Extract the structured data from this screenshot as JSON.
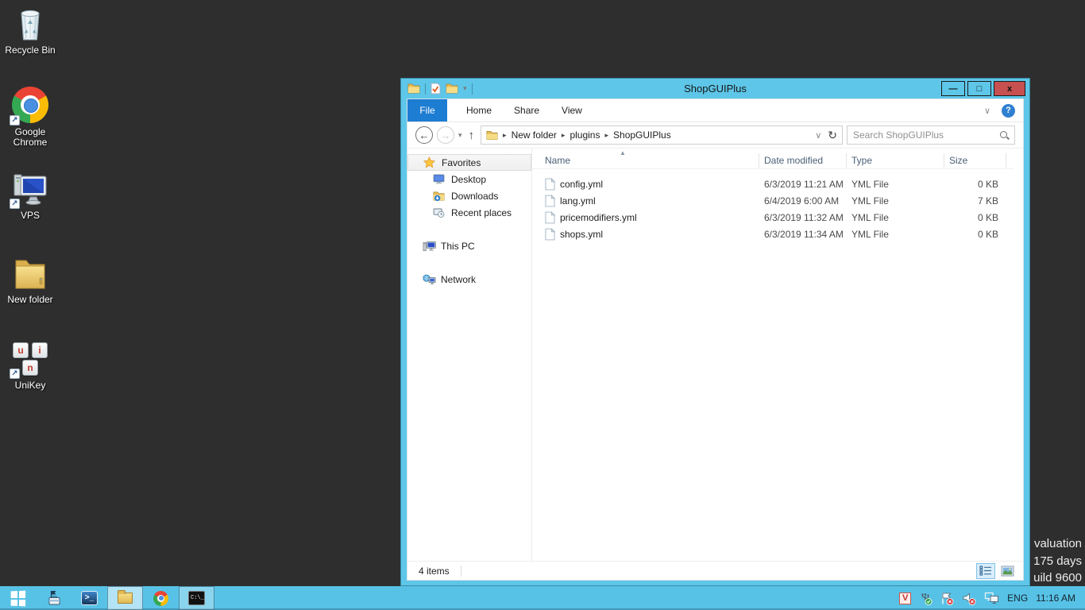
{
  "colors": {
    "desktop_bg": "#2e2e2e",
    "window_frame_blue": "#5ec6e8",
    "taskbar_blue": "#58c2e6",
    "close_button_red": "#c75050",
    "file_tab_blue": "#1d7dd2",
    "accent_blue": "#2f80d0"
  },
  "desktop": {
    "icons": [
      {
        "icon": "recycle-bin-icon",
        "label": "Recycle Bin"
      },
      {
        "icon": "chrome-icon",
        "label": "Google Chrome"
      },
      {
        "icon": "remote-pc-icon",
        "label": "VPS"
      },
      {
        "icon": "folder-icon",
        "label": "New folder"
      },
      {
        "icon": "unikey-icon",
        "label": "UniKey"
      }
    ],
    "evaluation_lines": {
      "0": "valuation",
      "1": "175 days",
      "2": "uild 9600"
    }
  },
  "explorer": {
    "title": "ShopGUIPlus",
    "qat_icons": [
      "explorer-window-icon",
      "properties-icon",
      "new-folder-icon",
      "customize-qat-dropdown"
    ],
    "caption": {
      "minimize": "–",
      "maximize": "▫",
      "close": "x"
    },
    "tabs": {
      "0": "File",
      "1": "Home",
      "2": "Share",
      "3": "View"
    },
    "breadcrumb": {
      "0": "New folder",
      "1": "plugins",
      "2": "ShopGUIPlus"
    },
    "search": {
      "placeholder": "Search ShopGUIPlus"
    },
    "nav": {
      "items": {
        "0": "Favorites",
        "1": "Desktop",
        "2": "Downloads",
        "3": "Recent places",
        "4": "This PC",
        "5": "Network"
      }
    },
    "files": {
      "columns": {
        "0": "Name",
        "1": "Date modified",
        "2": "Type",
        "3": "Size"
      },
      "rows": [
        {
          "name": "config.yml",
          "date": "6/3/2019 11:21 AM",
          "type": "YML File",
          "size": "0 KB"
        },
        {
          "name": "lang.yml",
          "date": "6/4/2019 6:00 AM",
          "type": "YML File",
          "size": "7 KB"
        },
        {
          "name": "pricemodifiers.yml",
          "date": "6/3/2019 11:32 AM",
          "type": "YML File",
          "size": "0 KB"
        },
        {
          "name": "shops.yml",
          "date": "6/3/2019 11:34 AM",
          "type": "YML File",
          "size": "0 KB"
        }
      ]
    },
    "status": {
      "items_count": "4 items"
    }
  },
  "taskbar": {
    "buttons": [
      "start",
      "server-manager",
      "powershell",
      "file-explorer",
      "chrome",
      "command-prompt"
    ],
    "tray_icons": [
      "unikey-vietnamese",
      "usb-safely-remove",
      "action-center-flag",
      "volume-muted",
      "network-status"
    ],
    "tray": {
      "language": "ENG",
      "clock": "11:16 AM"
    }
  }
}
